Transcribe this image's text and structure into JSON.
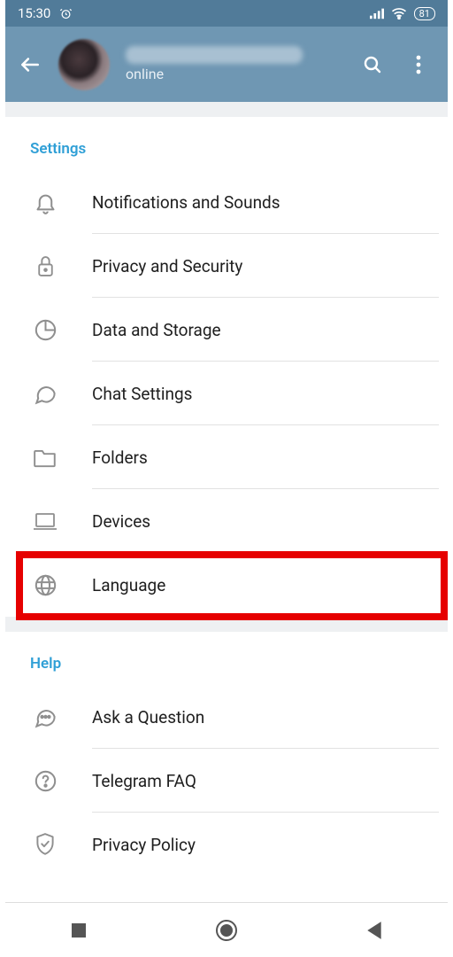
{
  "status": {
    "time": "15:30",
    "battery": "81"
  },
  "profile": {
    "status": "online"
  },
  "sections": {
    "settings_title": "Settings",
    "help_title": "Help"
  },
  "settings": {
    "notifications": "Notifications and Sounds",
    "privacy": "Privacy and Security",
    "data": "Data and Storage",
    "chat": "Chat Settings",
    "folders": "Folders",
    "devices": "Devices",
    "language": "Language"
  },
  "help": {
    "ask": "Ask a Question",
    "faq": "Telegram FAQ",
    "privacy_policy": "Privacy Policy"
  }
}
